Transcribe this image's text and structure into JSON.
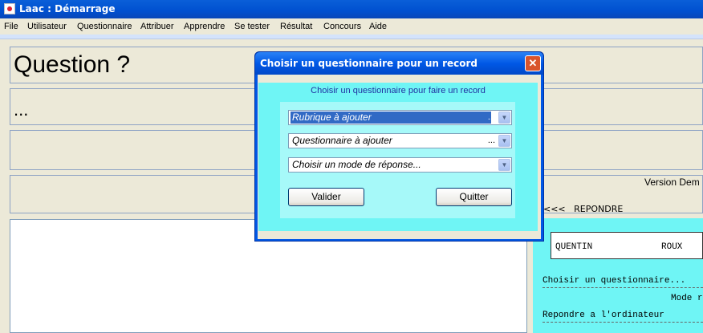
{
  "window": {
    "title": "Laac : Démarrage"
  },
  "menu": [
    "File",
    "Utilisateur",
    "Questionnaire",
    "Attribuer",
    "Apprendre",
    "Se tester",
    "Résultat",
    "Concours",
    "Aide"
  ],
  "main": {
    "question": "Question ?",
    "answer_placeholder": "...",
    "version": "Version Dem",
    "nav_prev": "<<<",
    "nav_answer": "REPONDRE",
    "user_first": "QUENTIN",
    "user_last": "ROUX",
    "choose_questionnaire": "Choisir un questionnaire...",
    "mode": "Mode r",
    "answer_to_computer": "Repondre a l'ordinateur"
  },
  "dialog": {
    "title": "Choisir un questionnaire pour un record",
    "subtitle": "Choisir un questionnaire pour faire un record",
    "combo_rubrique": "Rubrique à ajouter",
    "combo_questionnaire": "Questionnaire à ajouter",
    "combo_mode": "Choisir un mode de réponse...",
    "ellipsis": "...",
    "validate_label": "Valider",
    "quit_label": "Quitter"
  },
  "colors": {
    "accent": "#0058e6",
    "cyan_panel": "#6ff5f5",
    "selection": "#316ac5"
  }
}
